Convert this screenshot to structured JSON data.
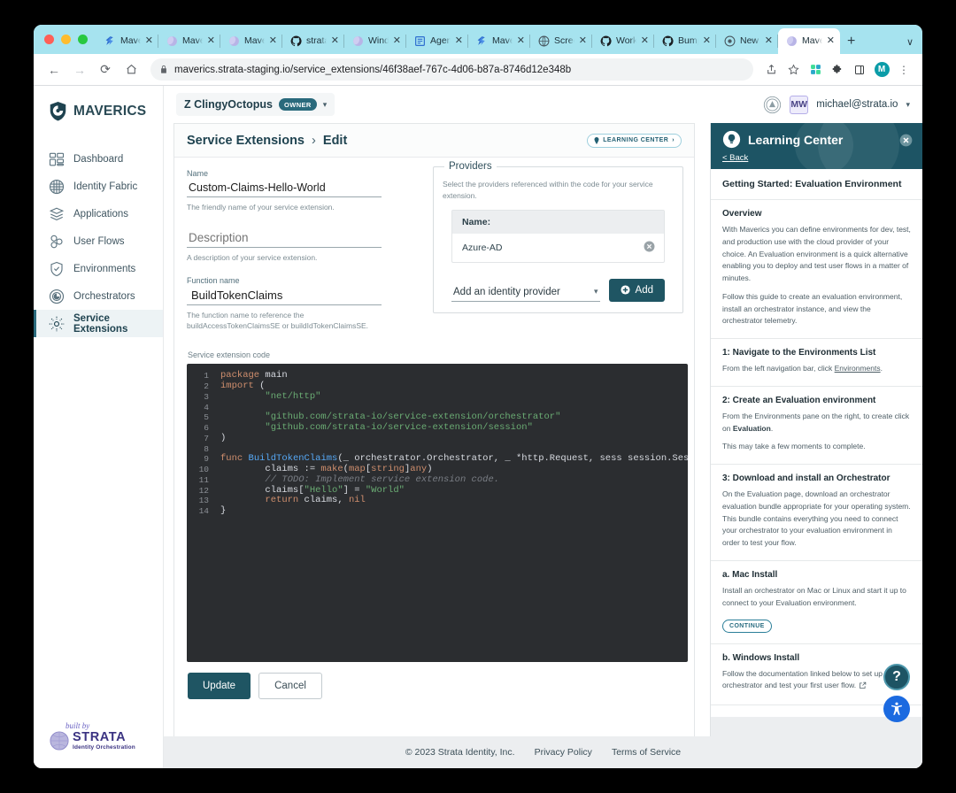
{
  "browser": {
    "tabs": [
      {
        "title": "Maverics",
        "favicon": "maverics-icon",
        "active": false
      },
      {
        "title": "Maverics",
        "favicon": "maverics-purple-icon",
        "active": false
      },
      {
        "title": "Maverics",
        "favicon": "maverics-purple-icon",
        "active": false
      },
      {
        "title": "strata-i",
        "favicon": "github-icon",
        "active": false
      },
      {
        "title": "Windows",
        "favicon": "maverics-purple-icon",
        "active": false
      },
      {
        "title": "Agenda",
        "favicon": "doc-icon",
        "active": false
      },
      {
        "title": "Maverics",
        "favicon": "maverics-icon",
        "active": false
      },
      {
        "title": "Screens",
        "favicon": "globe-icon",
        "active": false
      },
      {
        "title": "Workflo",
        "favicon": "github-icon",
        "active": false
      },
      {
        "title": "Bump C",
        "favicon": "github-icon",
        "active": false
      },
      {
        "title": "New Tab",
        "favicon": "chrome-icon",
        "active": false
      },
      {
        "title": "Maverics",
        "favicon": "maverics-purple-icon",
        "active": true
      }
    ],
    "new_tab_label": "+",
    "tab_list_label": "∨",
    "close_glyph": "✕",
    "nav": {
      "back": "←",
      "forward": "→",
      "reload": "⟳",
      "home": "⌂"
    },
    "url": "maverics.strata-staging.io/service_extensions/46f38aef-767c-4d06-b87a-8746d12e348b",
    "lock_glyph": "ὑ2",
    "toolbar_icons": [
      "share-icon",
      "bookmark-star-icon",
      "extension-color-icon",
      "puzzle-icon",
      "sidepanel-icon"
    ],
    "profile_initial": "M",
    "menu_glyph": "⋮"
  },
  "sidebar": {
    "brand": "MAVERICS",
    "items": [
      {
        "label": "Dashboard",
        "icon": "dashboard-icon"
      },
      {
        "label": "Identity Fabric",
        "icon": "identity-fabric-icon"
      },
      {
        "label": "Applications",
        "icon": "applications-layers-icon"
      },
      {
        "label": "User Flows",
        "icon": "user-flows-icon"
      },
      {
        "label": "Environments",
        "icon": "shield-check-icon"
      },
      {
        "label": "Orchestrators",
        "icon": "orchestrator-icon"
      },
      {
        "label": "Service Extensions",
        "icon": "service-extensions-icon"
      }
    ],
    "active_index": 6,
    "built_by": {
      "script": "built by",
      "name": "STRATA",
      "tagline": "Identity Orchestration"
    }
  },
  "header": {
    "org_name": "Z ClingyOctopus",
    "org_role_badge": "OWNER",
    "user_initials": "MW",
    "user_email": "michael@strata.io"
  },
  "page": {
    "breadcrumb_root": "Service Extensions",
    "breadcrumb_sep": "›",
    "breadcrumb_current": "Edit",
    "learning_center_badge": "LEARNING CENTER",
    "learning_center_badge_arrow": "›"
  },
  "form": {
    "name": {
      "label": "Name",
      "value": "Custom-Claims-Hello-World",
      "help": "The friendly name of your service extension."
    },
    "description": {
      "label": "",
      "placeholder": "Description",
      "value": "",
      "help": "A description of your service extension."
    },
    "function_name": {
      "label": "Function name",
      "value": "BuildTokenClaims",
      "help": "The function name to reference the buildAccessTokenClaimsSE or buildIdTokenClaimsSE."
    },
    "code_label": "Service extension code",
    "update_button": "Update",
    "cancel_button": "Cancel"
  },
  "providers": {
    "legend": "Providers",
    "description": "Select the providers referenced within the code for your service extension.",
    "column_header": "Name:",
    "rows": [
      {
        "name": "Azure-AD",
        "remove_icon": "remove-circle-icon"
      }
    ],
    "select_value": "Add an identity provider",
    "add_button": "Add"
  },
  "code": {
    "lines": [
      {
        "n": "1",
        "text": "package main"
      },
      {
        "n": "2",
        "text": "import ("
      },
      {
        "n": "3",
        "text": "        \"net/http\""
      },
      {
        "n": "4",
        "text": ""
      },
      {
        "n": "5",
        "text": "        \"github.com/strata-io/service-extension/orchestrator\""
      },
      {
        "n": "6",
        "text": "        \"github.com/strata-io/service-extension/session\""
      },
      {
        "n": "7",
        "text": ")"
      },
      {
        "n": "8",
        "text": ""
      },
      {
        "n": "9",
        "text": "func BuildTokenClaims(_ orchestrator.Orchestrator, _ *http.Request, sess session.Session) (ma"
      },
      {
        "n": "10",
        "text": "        claims := make(map[string]any)"
      },
      {
        "n": "11",
        "text": "        // TODO: Implement service extension code."
      },
      {
        "n": "12",
        "text": "        claims[\"Hello\"] = \"World\""
      },
      {
        "n": "13",
        "text": "        return claims, nil"
      },
      {
        "n": "14",
        "text": "}"
      }
    ]
  },
  "learning_center": {
    "title": "Learning Center",
    "back_label": "< Back",
    "close_icon": "close-icon",
    "heading": "Getting Started: Evaluation Environment",
    "sections": [
      {
        "title": "Overview",
        "paragraphs": [
          "With Maverics you can define environments for dev, test, and production use with the cloud provider of your choice. An Evaluation environment is a quick alternative enabling you to deploy and test user flows in a matter of minutes.",
          "Follow this guide to create an evaluation environment, install an orchestrator instance, and view the orchestrator telemetry."
        ]
      },
      {
        "title": "1: Navigate to the Environments List",
        "paragraphs": [
          "From the left navigation bar, click Environments."
        ]
      },
      {
        "title": "2: Create an Evaluation environment",
        "paragraphs": [
          "From the Environments pane on the right, to create click on Evaluation.",
          "This may take a few moments to complete."
        ]
      },
      {
        "title": "3: Download and install an Orchestrator",
        "paragraphs": [
          "On the Evaluation page, download an orchestrator evaluation bundle appropriate for your operating system. This bundle contains everything you need to connect your orchestrator to your evaluation environment in order to test your flow."
        ]
      },
      {
        "title": "a. Mac Install",
        "paragraphs": [
          "Install an orchestrator on Mac or Linux and start it up to connect to your Evaluation environment."
        ],
        "button": "CONTINUE"
      },
      {
        "title": "b. Windows Install",
        "paragraphs": [
          "Follow the documentation linked below to set up your orchestrator and test your first user flow."
        ],
        "external_link_icon": "external-link-icon"
      }
    ]
  },
  "footer": {
    "copyright": "© 2023 Strata Identity, Inc.",
    "links": [
      "Privacy Policy",
      "Terms of Service"
    ]
  },
  "fabs": {
    "help": "?",
    "accessibility": "accessibility-icon"
  },
  "colors": {
    "brand_teal": "#1f5563",
    "lc_header": "#1d5464",
    "tabstrip": "#a6e3ef",
    "editor_bg": "#2b2d30",
    "accent_blue": "#1b6ae0"
  }
}
